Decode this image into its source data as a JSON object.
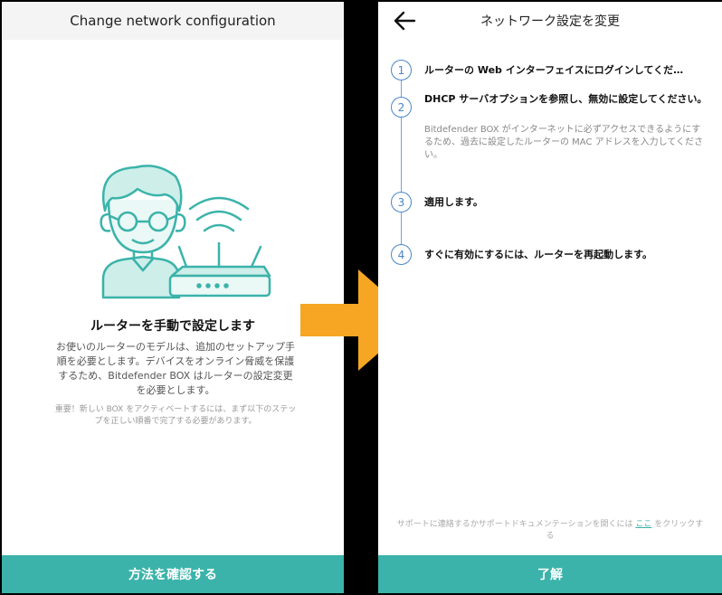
{
  "left": {
    "header": "Change network configuration",
    "title": "ルーターを手動で設定します",
    "description": "お使いのルーターのモデルは、追加のセットアップ手順を必要とします。デバイスをオンライン脅威を保護するため、Bitdefender BOX はルーターの設定変更を必要とします。",
    "note": "重要！新しい BOX をアクティベートするには、まず以下のステップを正しい順番で完了する必要があります。",
    "button": "方法を確認する"
  },
  "right": {
    "header": "ネットワーク設定を変更",
    "steps": [
      {
        "num": "1",
        "title": "ルーターの Web インターフェイスにログインしてくだ…"
      },
      {
        "num": "2",
        "title": "DHCP サーバオプションを参照し、無効に設定してください。",
        "desc": "Bitdefender BOX がインターネットに必ずアクセスできるようにするため、過去に設定したルーターの MAC アドレスを入力してください。"
      },
      {
        "num": "3",
        "title": "適用します。"
      },
      {
        "num": "4",
        "title": "すぐに有効にするには、ルーターを再起動します。"
      }
    ],
    "support_before": "サポートに連絡するかサポートドキュメンテーションを開くには ",
    "support_link": "ここ",
    "support_after": " をクリックする",
    "button": "了解"
  },
  "colors": {
    "accent": "#3bb3aa",
    "step_blue": "#4a86c8",
    "arrow": "#f6a623"
  },
  "icons": [
    "back-arrow-icon",
    "person-illustration",
    "router-illustration",
    "transition-arrow"
  ]
}
